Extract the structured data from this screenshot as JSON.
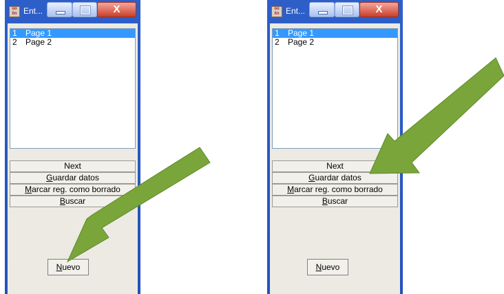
{
  "windows": [
    {
      "title": "Ent...",
      "close_glyph": "X",
      "app_icon_text": "oo/\nlin",
      "list": [
        {
          "num": "1",
          "label": "Page 1",
          "selected": true
        },
        {
          "num": "2",
          "label": "Page 2",
          "selected": false
        }
      ],
      "buttons": {
        "next": "Next",
        "guardar_mn": "G",
        "guardar_rest": "uardar datos",
        "marcar_mn": "M",
        "marcar_rest": "arcar reg. como borrado",
        "buscar_mn": "B",
        "buscar_rest": "uscar",
        "nuevo_mn": "N",
        "nuevo_rest": "uevo"
      },
      "arrow_color": "#7aa53a"
    },
    {
      "title": "Ent...",
      "close_glyph": "X",
      "app_icon_text": "oo/\nlin",
      "list": [
        {
          "num": "1",
          "label": "Page 1",
          "selected": true
        },
        {
          "num": "2",
          "label": "Page 2",
          "selected": false
        }
      ],
      "buttons": {
        "next": "Next",
        "guardar_mn": "G",
        "guardar_rest": "uardar datos",
        "marcar_mn": "M",
        "marcar_rest": "arcar reg. como borrado",
        "buscar_mn": "B",
        "buscar_rest": "uscar",
        "nuevo_mn": "N",
        "nuevo_rest": "uevo"
      },
      "arrow_color": "#7aa53a"
    }
  ]
}
